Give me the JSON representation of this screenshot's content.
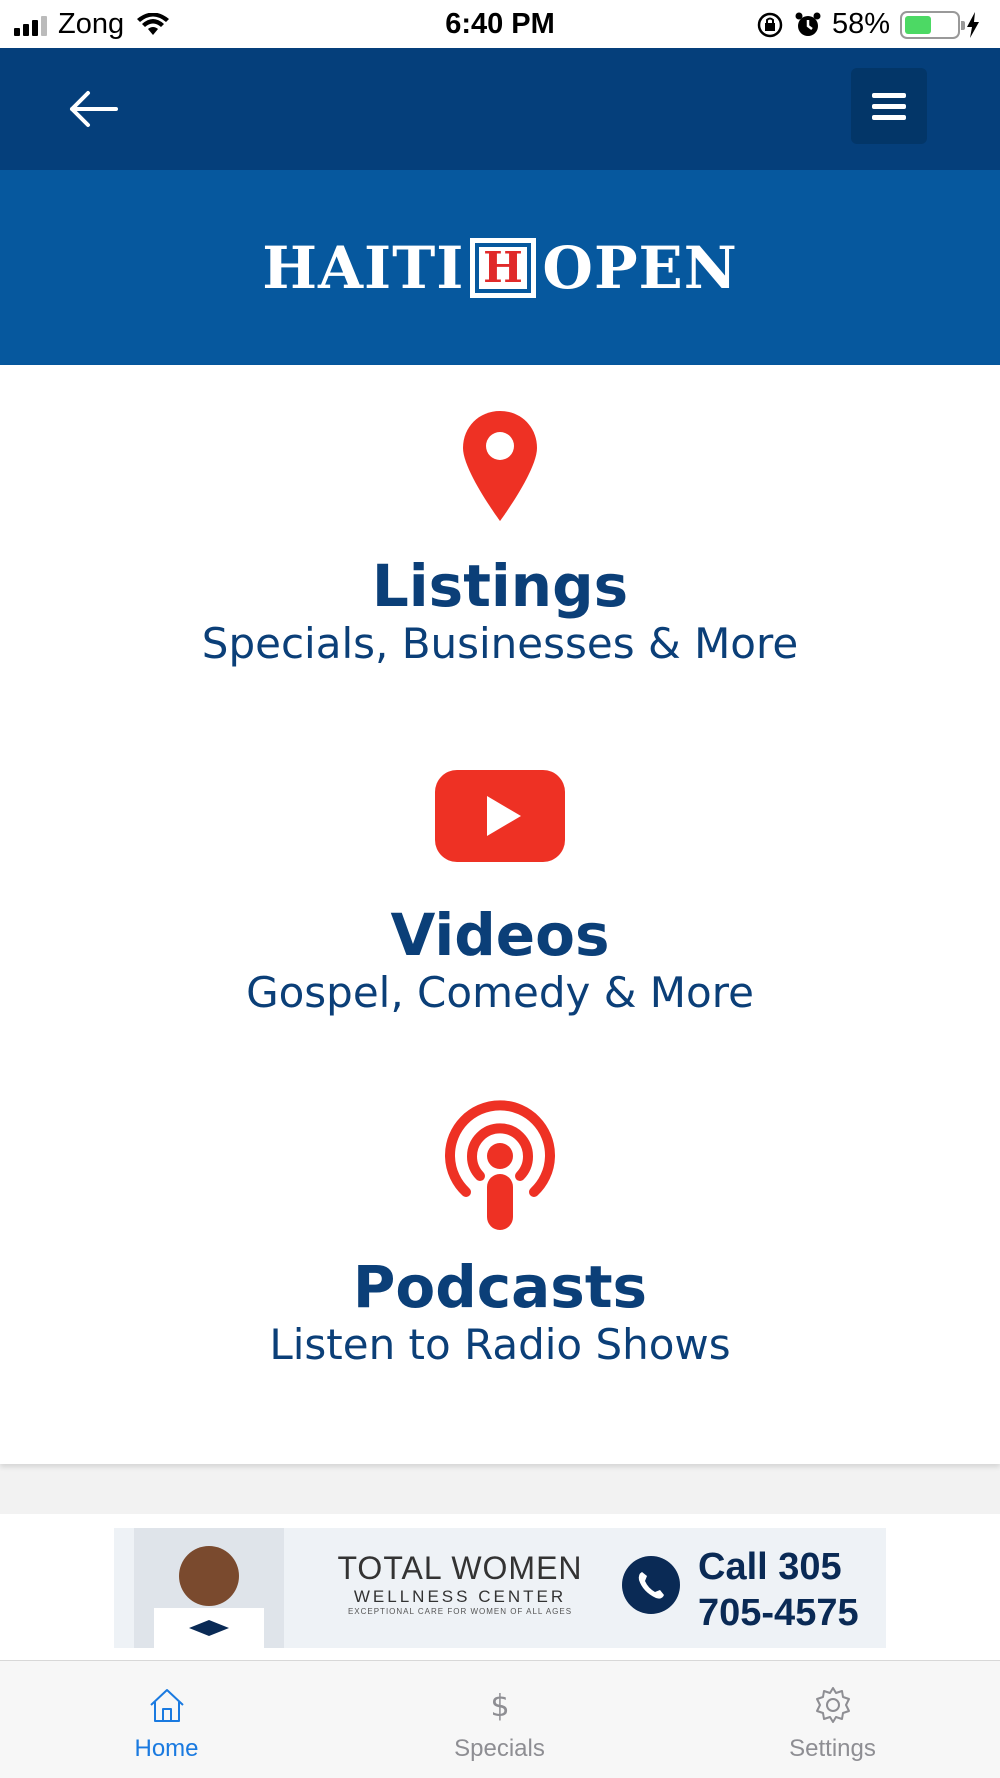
{
  "status_bar": {
    "carrier": "Zong",
    "time": "6:40 PM",
    "battery_percent": "58%",
    "battery_level": 0.58,
    "icons": [
      "signal-icon",
      "wifi-icon",
      "orientation-lock-icon",
      "alarm-icon",
      "battery-icon",
      "charging-icon"
    ]
  },
  "header": {
    "back_icon": "arrow-left-icon",
    "menu_icon": "hamburger-menu-icon",
    "logo_left": "HAITI",
    "logo_mark": "H",
    "logo_right": "OPEN"
  },
  "menu": [
    {
      "title": "Listings",
      "subtitle": "Specials, Businesses & More",
      "icon": "map-pin-icon"
    },
    {
      "title": "Videos",
      "subtitle": "Gospel, Comedy & More",
      "icon": "youtube-play-icon"
    },
    {
      "title": "Podcasts",
      "subtitle": "Listen to Radio Shows",
      "icon": "podcast-icon"
    }
  ],
  "ad": {
    "brand_line1": "TOTAL  WOMEN",
    "brand_line2": "WELLNESS  CENTER",
    "brand_line3": "EXCEPTIONAL CARE FOR WOMEN OF ALL AGES",
    "call_line1": "Call  305",
    "call_line2": "705-4575"
  },
  "tabs": [
    {
      "label": "Home",
      "icon": "home-icon",
      "active": true
    },
    {
      "label": "Specials",
      "icon": "dollar-icon",
      "active": false
    },
    {
      "label": "Settings",
      "icon": "gear-icon",
      "active": false
    }
  ],
  "colors": {
    "header_dark": "#053f7b",
    "header_logo_band": "#06589e",
    "title_blue": "#0b3f78",
    "icon_red": "#ee3124",
    "tab_active": "#1a7ae0",
    "tab_inactive": "#8e8e93"
  }
}
